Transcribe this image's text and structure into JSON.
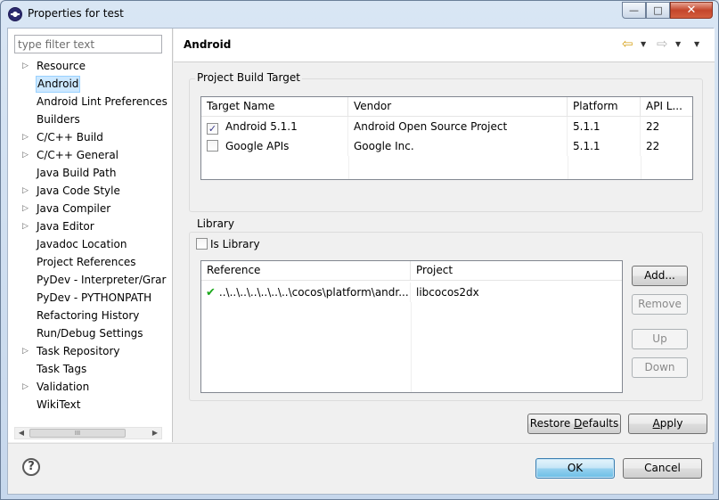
{
  "window": {
    "title": "Properties for test",
    "minimize_glyph": "—",
    "maximize_glyph": "□",
    "close_glyph": "✕"
  },
  "sidebar": {
    "filter_placeholder": "type filter text",
    "items": [
      {
        "label": "Resource",
        "expandable": true
      },
      {
        "label": "Android",
        "expandable": false,
        "selected": true
      },
      {
        "label": "Android Lint Preferences",
        "expandable": false
      },
      {
        "label": "Builders",
        "expandable": false
      },
      {
        "label": "C/C++ Build",
        "expandable": true
      },
      {
        "label": "C/C++ General",
        "expandable": true
      },
      {
        "label": "Java Build Path",
        "expandable": false
      },
      {
        "label": "Java Code Style",
        "expandable": true
      },
      {
        "label": "Java Compiler",
        "expandable": true
      },
      {
        "label": "Java Editor",
        "expandable": true
      },
      {
        "label": "Javadoc Location",
        "expandable": false
      },
      {
        "label": "Project References",
        "expandable": false
      },
      {
        "label": "PyDev - Interpreter/Grar",
        "expandable": false
      },
      {
        "label": "PyDev - PYTHONPATH",
        "expandable": false
      },
      {
        "label": "Refactoring History",
        "expandable": false
      },
      {
        "label": "Run/Debug Settings",
        "expandable": false
      },
      {
        "label": "Task Repository",
        "expandable": true
      },
      {
        "label": "Task Tags",
        "expandable": false
      },
      {
        "label": "Validation",
        "expandable": true
      },
      {
        "label": "WikiText",
        "expandable": false
      }
    ],
    "scroll_left_glyph": "◀",
    "scroll_thumb_glyph": "III",
    "scroll_right_glyph": "▶"
  },
  "page": {
    "title": "Android",
    "back_glyph": "⇦",
    "forward_glyph": "⇨",
    "dropdown_glyph": "▼"
  },
  "build_target": {
    "group_label": "Project Build Target",
    "columns": [
      "Target Name",
      "Vendor",
      "Platform",
      "API L..."
    ],
    "rows": [
      {
        "checked": true,
        "name": "Android 5.1.1",
        "vendor": "Android Open Source Project",
        "platform": "5.1.1",
        "api": "22"
      },
      {
        "checked": false,
        "name": "Google APIs",
        "vendor": "Google Inc.",
        "platform": "5.1.1",
        "api": "22"
      }
    ]
  },
  "library": {
    "group_label": "Library",
    "is_library_label": "Is Library",
    "is_library_checked": false,
    "columns": [
      "Reference",
      "Project"
    ],
    "rows": [
      {
        "reference": "..\\..\\..\\..\\..\\..\\..\\cocos\\platform\\andr...",
        "project": "libcocos2dx"
      }
    ],
    "check_glyph": "✔",
    "buttons": {
      "add": "Add...",
      "remove": "Remove",
      "up": "Up",
      "down": "Down"
    }
  },
  "actions": {
    "restore_pre": "Restore ",
    "restore_u": "D",
    "restore_post": "efaults",
    "apply_u": "A",
    "apply_post": "pply",
    "ok": "OK",
    "cancel": "Cancel",
    "help_glyph": "?"
  },
  "colors": {
    "selection": "#cce8ff",
    "accent_back": "#d7a21b",
    "library_check": "#1aa81a"
  }
}
